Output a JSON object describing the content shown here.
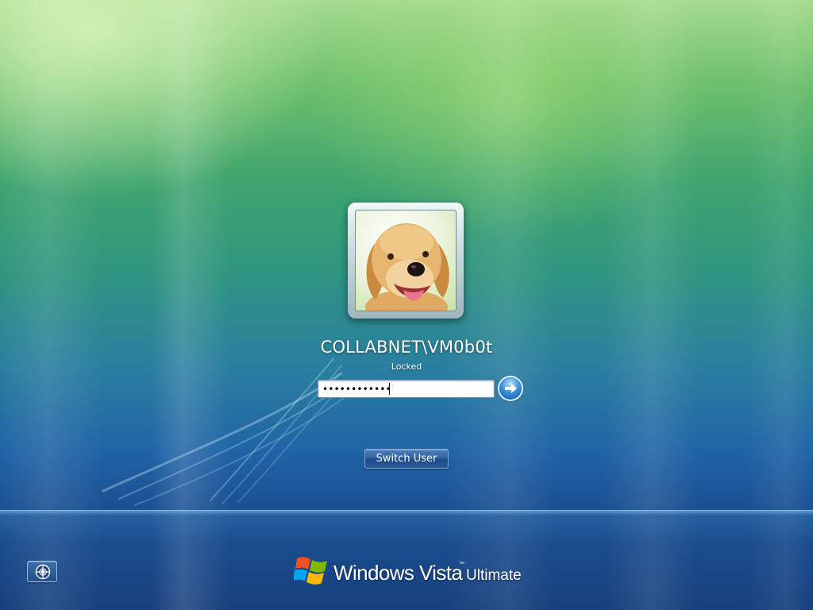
{
  "user": {
    "name": "COLLABNET\\VM0b0t",
    "status": "Locked",
    "picture_icon": "dog-photo-icon"
  },
  "password": {
    "value": "••••••••••••"
  },
  "buttons": {
    "submit_icon": "arrow-right-icon",
    "switch_user_label": "Switch User",
    "ease_of_access_icon": "ease-of-access-icon"
  },
  "branding": {
    "name": "Windows Vista",
    "trademark": "™",
    "edition": "Ultimate",
    "logo_icon": "windows-flag-icon"
  },
  "colors": {
    "background_top": "#a6db8e",
    "background_bottom": "#173f7c",
    "button_blue": "#2e5f9e",
    "text": "#ffffff"
  }
}
